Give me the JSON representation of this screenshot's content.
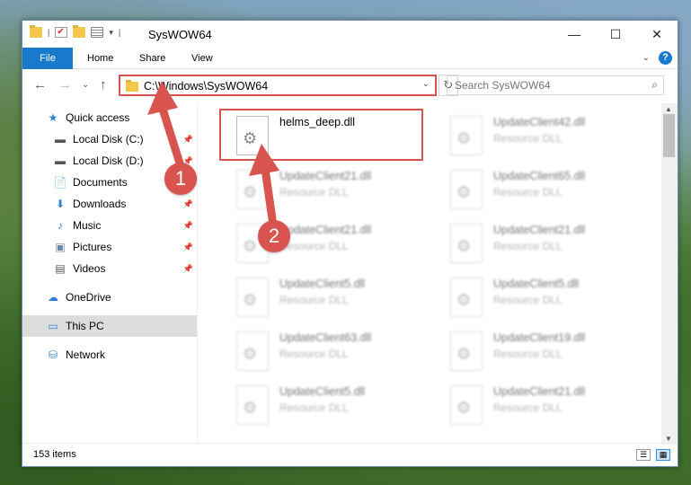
{
  "window": {
    "title": "SysWOW64",
    "minimize": "—",
    "maximize": "☐",
    "close": "✕"
  },
  "ribbon": {
    "tabs": [
      "File",
      "Home",
      "Share",
      "View"
    ],
    "help": "?",
    "expand": "⌄"
  },
  "nav": {
    "back": "←",
    "forward": "→",
    "recent": "⌄",
    "up": "↑",
    "address": "C:\\Windows\\SysWOW64",
    "refresh": "↻",
    "search_placeholder": "Search SysWOW64"
  },
  "sidebar": {
    "items": [
      {
        "label": "Quick access",
        "icon": "star-icon",
        "glyph": "★"
      },
      {
        "label": "Local Disk (C:)",
        "icon": "drive-icon",
        "glyph": "▬",
        "pinned": true
      },
      {
        "label": "Local Disk (D:)",
        "icon": "drive-icon",
        "glyph": "▬",
        "pinned": true
      },
      {
        "label": "Documents",
        "icon": "documents-icon",
        "glyph": "📄",
        "pinned": true
      },
      {
        "label": "Downloads",
        "icon": "download-icon",
        "glyph": "⬇",
        "pinned": true
      },
      {
        "label": "Music",
        "icon": "music-icon",
        "glyph": "♪",
        "pinned": true
      },
      {
        "label": "Pictures",
        "icon": "pictures-icon",
        "glyph": "▣",
        "pinned": true
      },
      {
        "label": "Videos",
        "icon": "videos-icon",
        "glyph": "▤",
        "pinned": true
      },
      {
        "label": "OneDrive",
        "icon": "cloud-icon",
        "glyph": "☁"
      },
      {
        "label": "This PC",
        "icon": "computer-icon",
        "glyph": "▭",
        "selected": true
      },
      {
        "label": "Network",
        "icon": "network-icon",
        "glyph": "⛁"
      }
    ]
  },
  "files": [
    {
      "name": "helms_deep.dll",
      "type": ""
    },
    {
      "name": "UpdateClient42.dll",
      "type": "Resource DLL"
    },
    {
      "name": "UpdateClient21.dll",
      "type": "Resource DLL"
    },
    {
      "name": "UpdateClient65.dll",
      "type": "Resource DLL"
    },
    {
      "name": "UpdateClient21.dll",
      "type": "Resource DLL"
    },
    {
      "name": "UpdateClient21.dll",
      "type": "Resource DLL"
    },
    {
      "name": "UpdateClient5.dll",
      "type": "Resource DLL"
    },
    {
      "name": "UpdateClient5.dll",
      "type": "Resource DLL"
    },
    {
      "name": "UpdateClient63.dll",
      "type": "Resource DLL"
    },
    {
      "name": "UpdateClient19.dll",
      "type": "Resource DLL"
    },
    {
      "name": "UpdateClient5.dll",
      "type": "Resource DLL"
    },
    {
      "name": "UpdateClient21.dll",
      "type": "Resource DLL"
    }
  ],
  "status": {
    "count": "153 items"
  },
  "annotations": {
    "step1": "1",
    "step2": "2",
    "color": "#d9534f"
  }
}
